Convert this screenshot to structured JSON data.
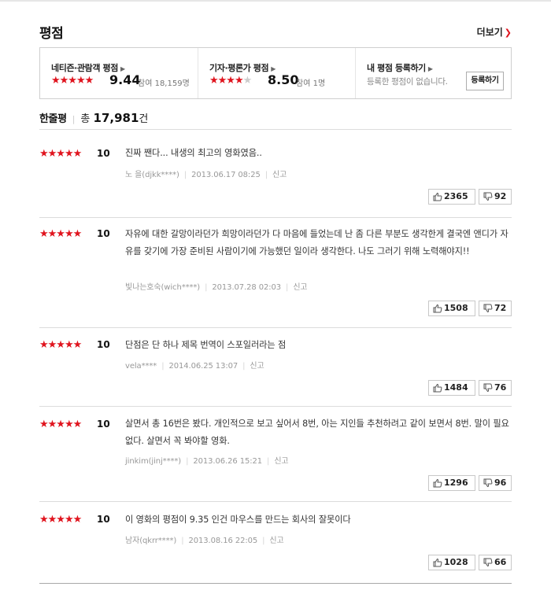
{
  "section": {
    "title": "평점",
    "more_label": "더보기"
  },
  "score_box": {
    "netizen": {
      "label": "네티즌·관람객 평점",
      "stars": 5,
      "score": "9.44",
      "participants": "참여 18,159명"
    },
    "critic": {
      "label": "기자·평론가 평점",
      "stars": 4,
      "score": "8.50",
      "participants": "참여 1명"
    },
    "mine": {
      "label": "내 평점 등록하기",
      "empty_text": "등록한 평점이 없습니다.",
      "button_label": "등록하기"
    }
  },
  "comments_header": {
    "label": "한줄평",
    "total_prefix": "총",
    "total_count": "17,981",
    "total_suffix": "건"
  },
  "reviews": [
    {
      "stars": "★★★★★",
      "score": "10",
      "text": "진짜 짼다... 내생의 최고의 영화였음..",
      "author": "노 을(djkk****)",
      "date": "2013.06.17 08:25",
      "report": "신고",
      "up": "2365",
      "down": "92"
    },
    {
      "stars": "★★★★★",
      "score": "10",
      "text": "자유에 대한 갈망이라던가 희망이라던가 다 마음에 들었는데 난 좀 다른 부분도 생각한게 결국엔 앤디가 자유를 갖기에 가장 준비된 사람이기에 가능했던 일이라 생각한다. 나도 그러기 위해 노력해야지!!",
      "author": "빛나는호숙(wich****)",
      "date": "2013.07.28 02:03",
      "report": "신고",
      "up": "1508",
      "down": "72"
    },
    {
      "stars": "★★★★★",
      "score": "10",
      "text": "단점은 단 하나 제목 번역이 스포일러라는 점",
      "author": "vela****",
      "date": "2014.06.25 13:07",
      "report": "신고",
      "up": "1484",
      "down": "76"
    },
    {
      "stars": "★★★★★",
      "score": "10",
      "text": "살면서 총 16번은 봤다. 개인적으로 보고 싶어서 8번, 아는 지인들 추천하려고 같이 보면서 8번. 말이 필요 없다. 살면서 꼭 봐야할 영화.",
      "author": "jinkim(jinj****)",
      "date": "2013.06.26 15:21",
      "report": "신고",
      "up": "1296",
      "down": "96"
    },
    {
      "stars": "★★★★★",
      "score": "10",
      "text": "이 영화의 평점이 9.35 인건 마우스를 만드는 회사의 잘못이다",
      "author": "남자(qkrr****)",
      "date": "2013.08.16 22:05",
      "report": "신고",
      "up": "1028",
      "down": "66"
    }
  ],
  "colors": {
    "star_red": "#e0141e",
    "star_gray": "#cccccc",
    "accent_red": "#e0141e"
  },
  "icons": {
    "upvote": "thumbs-up-icon",
    "downvote": "thumbs-down-icon",
    "caret": "triangle-right-icon"
  }
}
